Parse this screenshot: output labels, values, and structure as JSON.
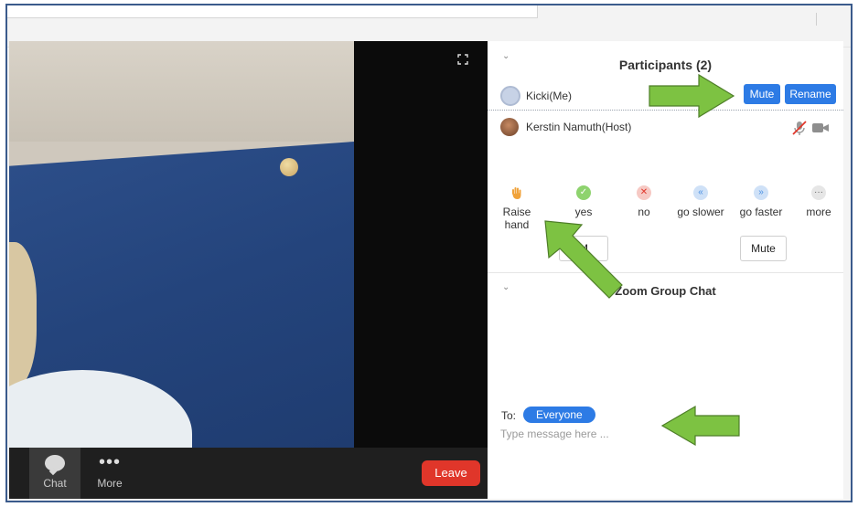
{
  "toolbar": {
    "chat_label": "Chat",
    "more_label": "More",
    "leave_label": "Leave"
  },
  "participants": {
    "title": "Participants (2)",
    "list": [
      {
        "name": "Kicki(Me)",
        "buttons": [
          "Mute",
          "Rename"
        ]
      },
      {
        "name": "Kerstin Namuth(Host)"
      }
    ]
  },
  "reactions": [
    {
      "label": "Raise hand",
      "icon": "raise-hand-icon",
      "color": "#f0a23a"
    },
    {
      "label": "yes",
      "icon": "check-icon",
      "color": "#6cc04a"
    },
    {
      "label": "no",
      "icon": "x-icon",
      "color": "#e0362a"
    },
    {
      "label": "go slower",
      "icon": "slower-icon",
      "color": "#4a90e2"
    },
    {
      "label": "go faster",
      "icon": "faster-icon",
      "color": "#4a90e2"
    },
    {
      "label": "more",
      "icon": "ellipsis-icon",
      "color": "#777777"
    }
  ],
  "participant_actions": {
    "left_button": "M",
    "mute_all": "Mute"
  },
  "chat": {
    "title": "Zoom Group Chat",
    "to_label": "To:",
    "recipient": "Everyone",
    "placeholder": "Type message here ..."
  },
  "colors": {
    "accent": "#2d7be5",
    "leave": "#e0362a",
    "arrow": "#7dc242"
  }
}
